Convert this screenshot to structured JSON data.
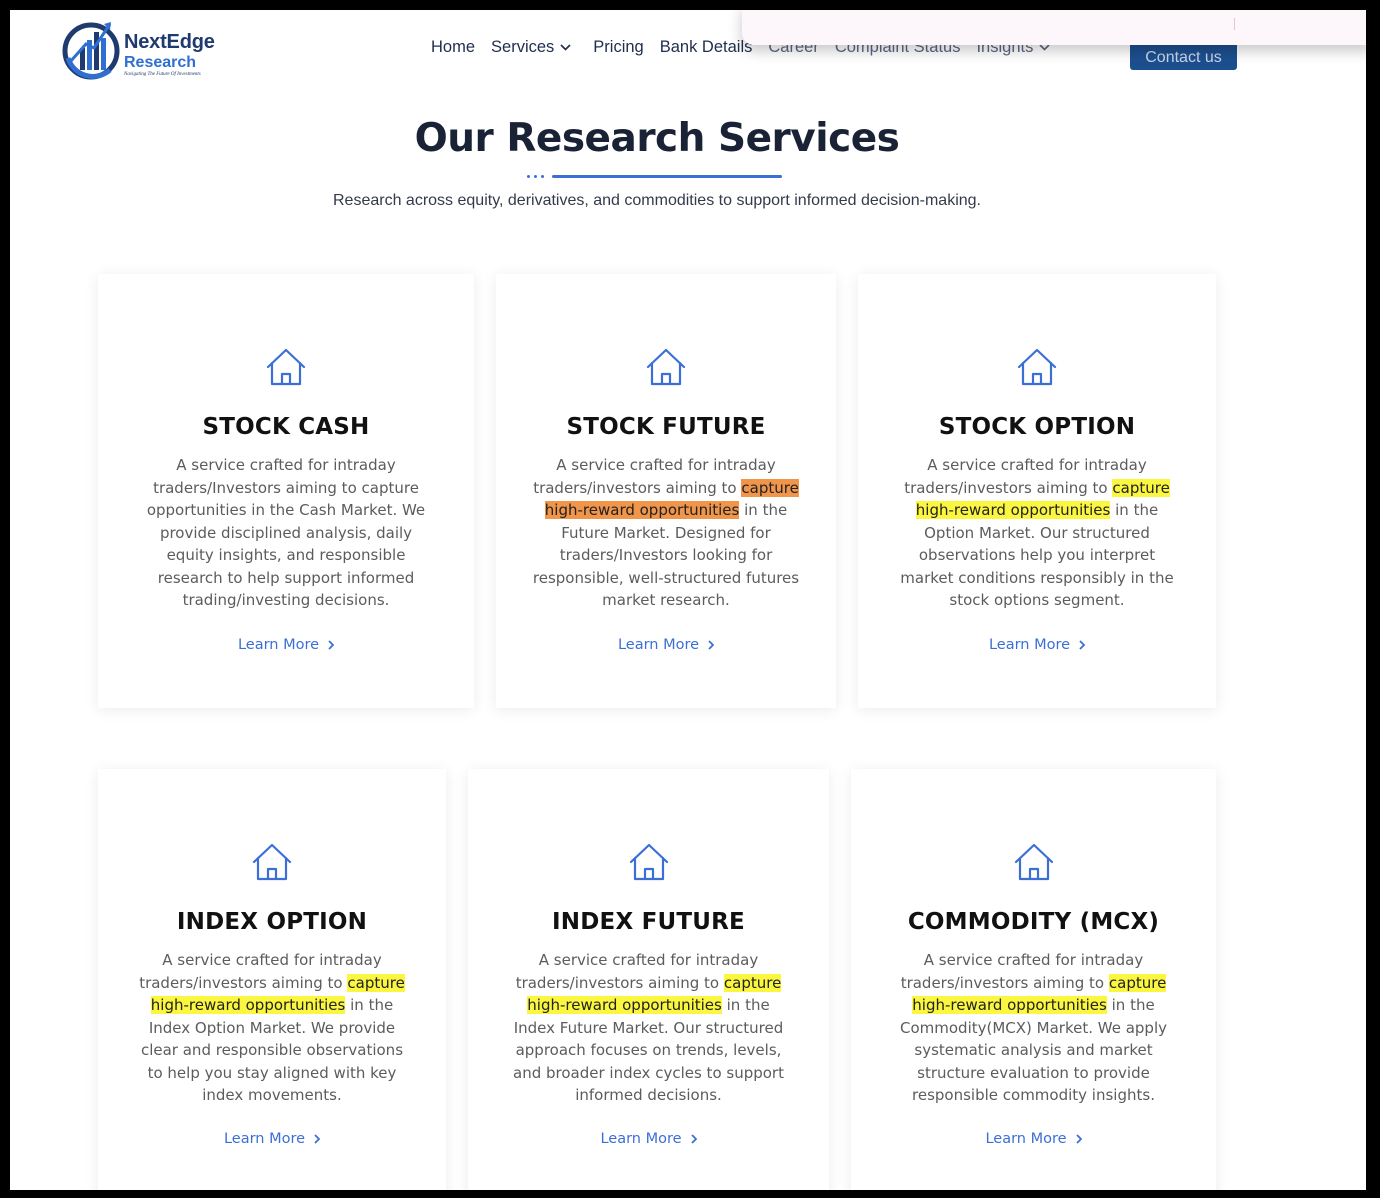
{
  "logo": {
    "name": "NextEdge",
    "sub": "Research",
    "tagline": "Navigating The Future Of Investments"
  },
  "nav": {
    "items": [
      {
        "label": "Home"
      },
      {
        "label": "Services"
      },
      {
        "label": "Pricing"
      },
      {
        "label": "Bank Details"
      },
      {
        "label": "Career"
      },
      {
        "label": "Complaint Status"
      },
      {
        "label": "Insights"
      }
    ],
    "contact_label": "Contact us"
  },
  "section": {
    "title": "Our Research Services",
    "subtitle": "Research across equity, derivatives, and commodities to support informed decision-making."
  },
  "cards": [
    {
      "title": "STOCK CASH",
      "desc_before": "A service crafted for intraday traders/Investors aiming to capture opportunities in the Cash Market. We provide disciplined analysis, daily equity insights, and responsible research to help support informed trading/investing decisions.",
      "highlight": "",
      "desc_after": "",
      "link": "Learn More"
    },
    {
      "title": "STOCK FUTURE",
      "desc_before": "A service crafted for intraday traders/investors aiming to ",
      "highlight": "capture high-reward opportunities",
      "desc_after": " in the Future Market. Designed for traders/Investors looking for responsible, well-structured futures market research.",
      "link": "Learn More"
    },
    {
      "title": "STOCK OPTION",
      "desc_before": "A service crafted for intraday traders/investors aiming to ",
      "highlight": "capture high-reward opportunities",
      "desc_after": " in the Option Market. Our structured observations help you interpret market conditions responsibly in the stock options segment.",
      "link": "Learn More"
    },
    {
      "title": "INDEX OPTION",
      "desc_before": "A service crafted for intraday traders/investors aiming to ",
      "highlight": "capture high-reward opportunities",
      "desc_after": " in the Index Option Market. We provide clear and responsible observations to help you stay aligned with key index movements.",
      "link": "Learn More"
    },
    {
      "title": "INDEX FUTURE",
      "desc_before": "A service crafted for intraday traders/investors aiming to ",
      "highlight": "capture high-reward opportunities",
      "desc_after": " in the Index Future Market. Our structured approach focuses on trends, levels, and broader index cycles to support informed decisions.",
      "link": "Learn More"
    },
    {
      "title": "COMMODITY (MCX)",
      "desc_before": "A service crafted for intraday traders/investors aiming to ",
      "highlight": "capture high-reward opportunities",
      "desc_after": " in the Commodity(MCX) Market. We apply systematic analysis and market structure evaluation to provide responsible commodity insights.",
      "link": "Learn More"
    }
  ],
  "colors": {
    "accent": "#3c6fd6",
    "highlight": "#fbf63f",
    "highlight_active": "#f0954a",
    "button": "#1d4f8f"
  }
}
